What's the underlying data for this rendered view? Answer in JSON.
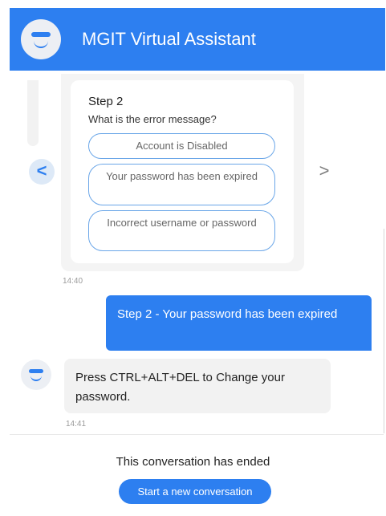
{
  "header": {
    "title": "MGIT Virtual Assistant",
    "avatar_icon": "bot-face-icon"
  },
  "colors": {
    "brand_blue": "#2d7ff0",
    "bubble_gray": "#f2f2f2",
    "option_border": "#6aa6e8"
  },
  "carousel": {
    "prev_icon": "chevron-left-icon",
    "prev_glyph": "<",
    "next_icon": "chevron-right-icon",
    "next_glyph": ">",
    "card": {
      "step_title": "Step 2",
      "question": "What is the error message?",
      "options": [
        "Account is Disabled",
        "Your password has been expired",
        "Incorrect username or password"
      ]
    },
    "timestamp": "14:40"
  },
  "messages": [
    {
      "sender": "user",
      "text": "Step 2 - Your password has been expired"
    },
    {
      "sender": "bot",
      "text": "Press CTRL+ALT+DEL to Change your password.",
      "timestamp": "14:41"
    }
  ],
  "footer": {
    "ended_text": "This conversation has ended",
    "new_conversation_label": "Start a new conversation"
  }
}
